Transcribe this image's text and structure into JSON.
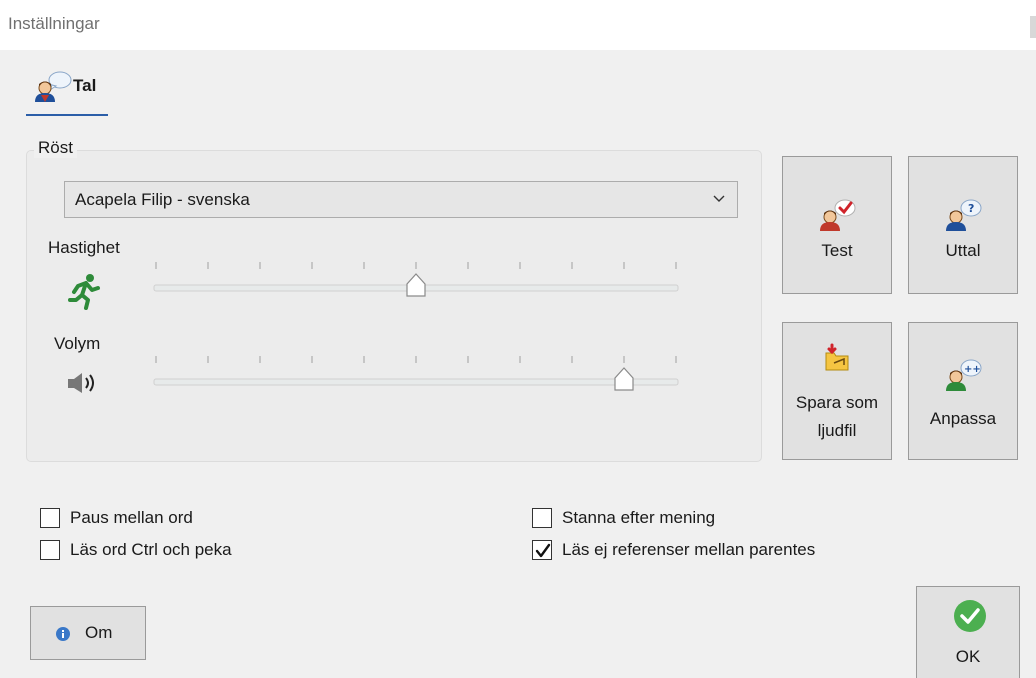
{
  "window": {
    "title": "Inställningar"
  },
  "tabs": [
    {
      "label": "Tal",
      "icon": "speaking-person-icon",
      "selected": true
    }
  ],
  "voice_group": {
    "legend": "Röst",
    "voice_select": {
      "value": "Acapela Filip -  svenska"
    },
    "speed": {
      "label": "Hastighet",
      "icon": "running-man-icon",
      "value_fraction": 0.5,
      "tick_count": 11
    },
    "volume": {
      "label": "Volym",
      "icon": "speaker-icon",
      "value_fraction": 0.9,
      "tick_count": 11
    }
  },
  "side_buttons": {
    "test": {
      "label": "Test",
      "icon": "person-checkmark-icon"
    },
    "uttal": {
      "label": "Uttal",
      "icon": "person-question-icon"
    },
    "spara": {
      "label_line1": "Spara som",
      "label_line2": "ljudfil",
      "icon": "save-audio-file-icon"
    },
    "anpassa": {
      "label": "Anpassa",
      "icon": "person-plus-icon"
    }
  },
  "options": {
    "paus_mellan_ord": {
      "label": "Paus mellan ord",
      "checked": false
    },
    "las_ord_ctrl": {
      "label": "Läs ord Ctrl och peka",
      "checked": false
    },
    "stanna_efter_mening": {
      "label": "Stanna efter mening",
      "checked": false
    },
    "las_ej_referenser": {
      "label": "Läs ej referenser mellan parentes",
      "checked": true
    }
  },
  "footer": {
    "om_button": {
      "label": "Om",
      "icon": "info-icon"
    },
    "ok_button": {
      "label": "OK",
      "icon": "green-check-icon"
    }
  },
  "colors": {
    "accent": "#2b5ea8",
    "ok_green": "#4caf50",
    "runner_green": "#2e8b3a"
  }
}
